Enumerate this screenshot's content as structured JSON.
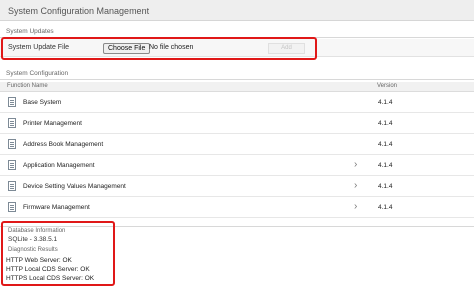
{
  "window": {
    "title": "System Configuration Management"
  },
  "updates": {
    "section_label": "System Updates",
    "file_label": "System Update File",
    "choose_label": "Choose File",
    "file_status": "No file chosen",
    "add_label": "Add"
  },
  "config": {
    "section_label": "System Configuration",
    "columns": {
      "function": "Function Name",
      "version": "Version"
    },
    "rows": [
      {
        "name": "Base System",
        "version": "4.1.4",
        "expandable": false
      },
      {
        "name": "Printer Management",
        "version": "4.1.4",
        "expandable": false
      },
      {
        "name": "Address Book Management",
        "version": "4.1.4",
        "expandable": false
      },
      {
        "name": "Application Management",
        "version": "4.1.4",
        "expandable": true
      },
      {
        "name": "Device Setting Values Management",
        "version": "4.1.4",
        "expandable": true
      },
      {
        "name": "Firmware Management",
        "version": "4.1.4",
        "expandable": true
      }
    ]
  },
  "database": {
    "title": "Database Information",
    "value": "SQLite - 3.38.5.1",
    "diagnostic_title": "Diagnostic Results",
    "diagnostics": [
      "HTTP Web Server: OK",
      "HTTP Local CDS Server: OK",
      "HTTPS Local CDS Server: OK"
    ]
  },
  "colors": {
    "highlight": "#e01818",
    "titlebar": "#eeeeee",
    "chevron": "#777777"
  },
  "icons": {
    "row": "document-icon",
    "expand": "chevron-right-icon"
  }
}
